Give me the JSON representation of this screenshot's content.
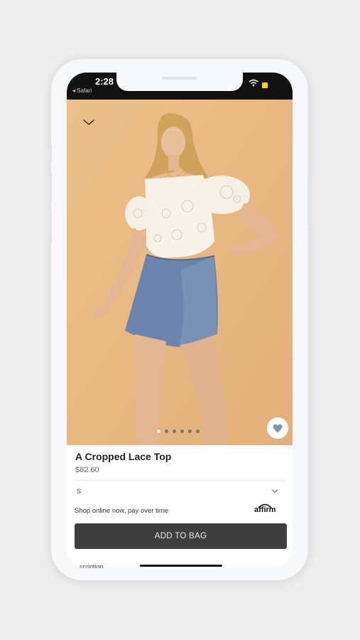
{
  "status_bar": {
    "time": "2:28",
    "back_app": "◂ Safari"
  },
  "product": {
    "title": "A Cropped Lace Top",
    "price": "$82.60",
    "image_dots": {
      "count": 6,
      "active_index": 0
    }
  },
  "size_select": {
    "value": "S"
  },
  "affirm": {
    "text": "Shop online now, pay over time",
    "logo": "affirm"
  },
  "add_to_bag_label": "ADD TO BAG",
  "description_peek": "scription",
  "icons": {
    "back": "chevron-down-icon",
    "favorite": "heart-icon",
    "size_dropdown": "chevron-down-icon"
  },
  "colors": {
    "background": "#ededee",
    "hero_background": "#e7b87f",
    "button": "#3f3f3f",
    "heart": "#7f95ab"
  }
}
